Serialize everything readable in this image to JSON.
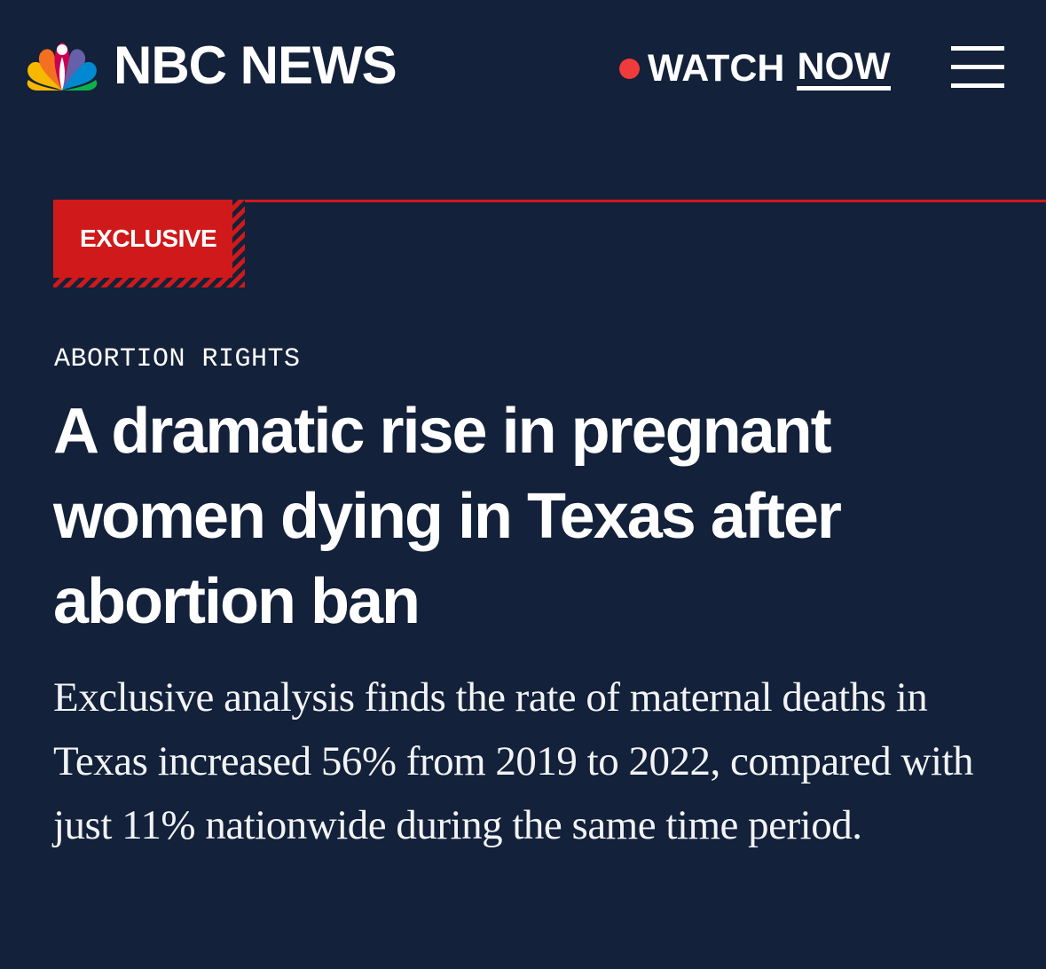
{
  "header": {
    "brand_name": "NBC NEWS",
    "logo_icon": "nbc-peacock-icon",
    "watch_label": "WATCH",
    "watch_now_label": "NOW",
    "live_indicator_color": "#ef3b3b",
    "menu_icon": "hamburger-menu-icon"
  },
  "article": {
    "badge": "EXCLUSIVE",
    "category": "ABORTION RIGHTS",
    "headline": "A dramatic rise in pregnant women dying in Texas after abortion ban",
    "dek": "Exclusive analysis finds the rate of maternal deaths in Texas increased 56% from 2019 to 2022, compared with just 11% nationwide during the same time period."
  },
  "colors": {
    "background": "#13213a",
    "accent_red": "#d0191a",
    "text": "#ffffff"
  }
}
